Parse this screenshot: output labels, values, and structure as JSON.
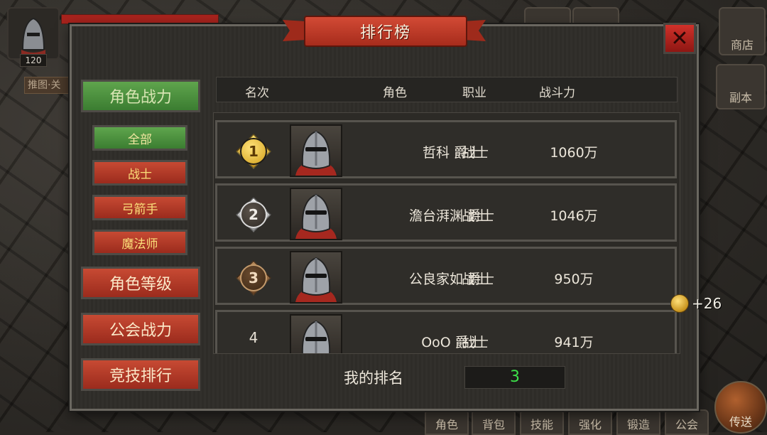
{
  "hud": {
    "level": "120",
    "hint": "推图·关",
    "top_buttons": [
      "商店"
    ],
    "side_button": "副本",
    "bottom_buttons": [
      "角色",
      "背包",
      "技能",
      "强化",
      "锻造",
      "公会"
    ],
    "teleport": "传送",
    "coin_bonus": "+26"
  },
  "panel": {
    "title": "排行榜",
    "close_symbol": "✕"
  },
  "menu": {
    "categories": [
      {
        "label": "角色战力",
        "active": true
      },
      {
        "label": "角色等级",
        "active": false
      },
      {
        "label": "公会战力",
        "active": false
      },
      {
        "label": "竞技排行",
        "active": false
      }
    ],
    "filters": [
      {
        "label": "全部",
        "active": true
      },
      {
        "label": "战士",
        "active": false
      },
      {
        "label": "弓箭手",
        "active": false
      },
      {
        "label": "魔法师",
        "active": false
      }
    ]
  },
  "table": {
    "headers": {
      "rank": "名次",
      "role": "角色",
      "job": "职业",
      "power": "战斗力"
    },
    "rows": [
      {
        "rank": "1",
        "medal": "gold",
        "name": "哲科 爵士",
        "job": "战士",
        "power": "1060万"
      },
      {
        "rank": "2",
        "medal": "silver",
        "name": "澹台湃渊 爵士",
        "job": "战士",
        "power": "1046万"
      },
      {
        "rank": "3",
        "medal": "bronze",
        "name": "公良家如 爵士",
        "job": "战士",
        "power": "950万"
      },
      {
        "rank": "4",
        "medal": "none",
        "name": "OoO 爵士",
        "job": "战士",
        "power": "941万"
      }
    ]
  },
  "my_rank": {
    "label": "我的排名",
    "value": "3"
  },
  "colors": {
    "active_green": "#4f9440",
    "inactive_red": "#b23a27",
    "my_rank_value": "#3de04a"
  }
}
